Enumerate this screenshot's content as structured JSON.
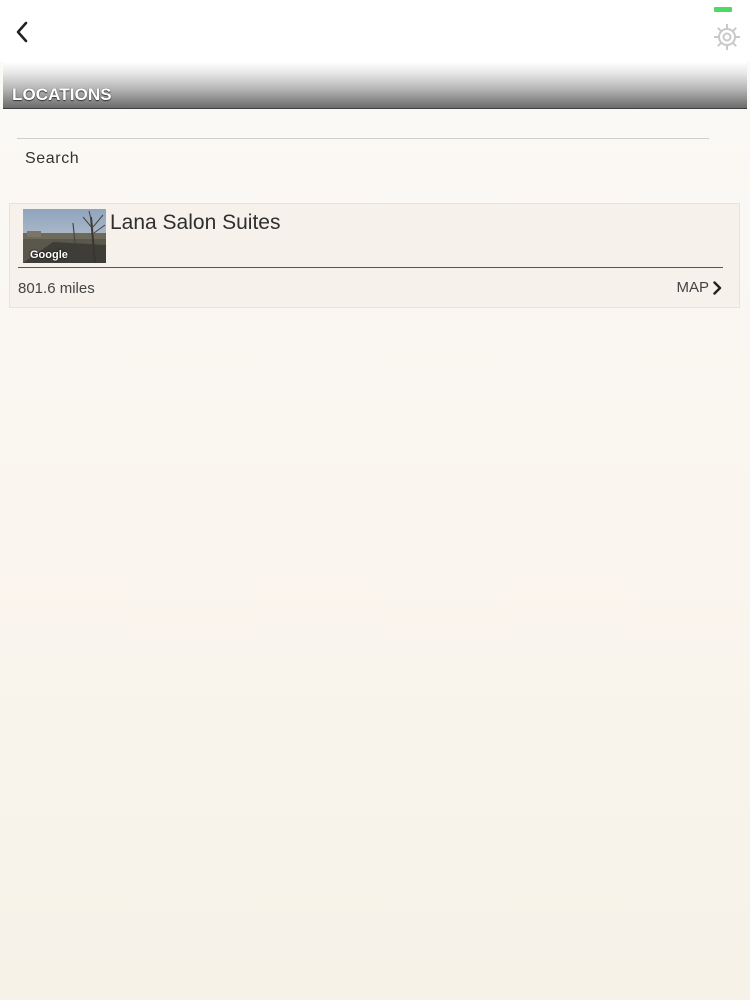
{
  "header": {
    "back_icon": "chevron-left-icon",
    "settings_icon": "gear-icon",
    "battery_color": "#4cd964"
  },
  "section": {
    "title": "LOCATIONS"
  },
  "search": {
    "placeholder": "Search",
    "value": ""
  },
  "locations": [
    {
      "name": "Lana Salon Suites",
      "thumbnail_watermark": "Google",
      "distance": "801.6 miles",
      "map_label": "MAP",
      "map_icon": "chevron-right-icon"
    }
  ],
  "colors": {
    "background": "#faf5ee",
    "card": "#f6f1ea",
    "text": "#333333"
  }
}
